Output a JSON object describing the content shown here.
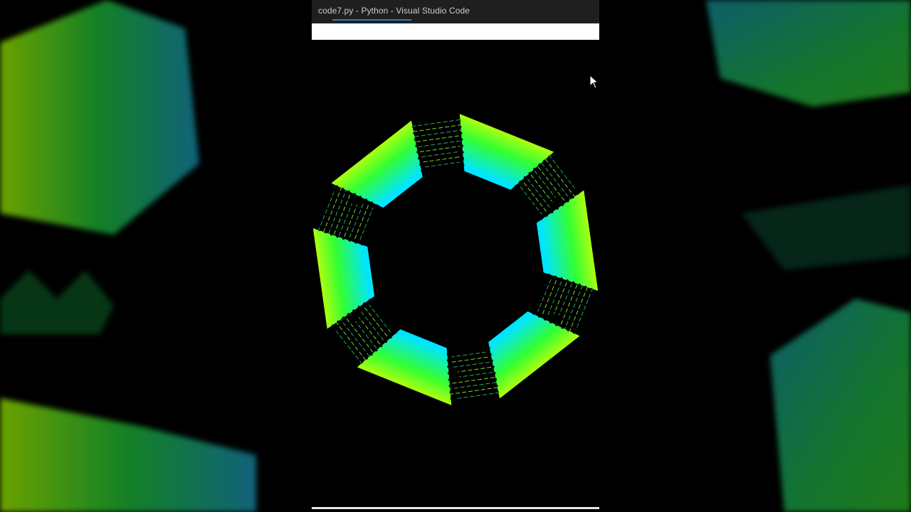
{
  "window": {
    "title": "code7.py - Python - Visual Studio Code"
  },
  "colors": {
    "titlebar_bg": "#1f1f1f",
    "title_text": "#cccccc",
    "accent_underline": "#2f7dc4",
    "shape_yellow": "#e6ff00",
    "shape_green": "#33ff33",
    "shape_cyan": "#00e5ff",
    "background": "#000000"
  },
  "icons": {
    "cursor": "mouse-pointer-icon"
  }
}
